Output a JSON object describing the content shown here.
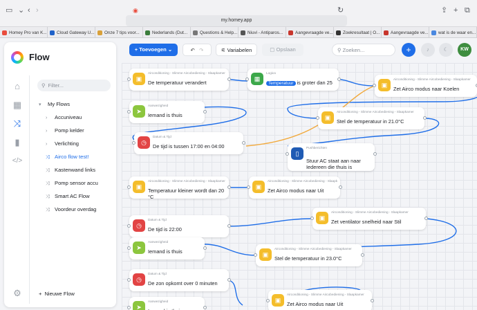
{
  "browser": {
    "url": "my.homey.app"
  },
  "bookmarks": [
    {
      "label": "Homey Pro van K...",
      "color": "#e94c3d"
    },
    {
      "label": "Cloud Gateway U...",
      "color": "#1f62c9"
    },
    {
      "label": "Onze 7 tips voor...",
      "color": "#d9a13a"
    },
    {
      "label": "Nederlands (Dut...",
      "color": "#3b7d3c"
    },
    {
      "label": "Questions & Help...",
      "color": "#777777"
    },
    {
      "label": "Niuvi - Antiparos...",
      "color": "#555555"
    },
    {
      "label": "Aangevraagde ve...",
      "color": "#c8362d"
    },
    {
      "label": "Zoekresultaat | O...",
      "color": "#333333"
    },
    {
      "label": "Aangevraagde ve...",
      "color": "#c8362d"
    },
    {
      "label": "wat is de waar en...",
      "color": "#4a88e0"
    }
  ],
  "sidebar": {
    "title": "Flow",
    "filter_placeholder": "Filter...",
    "nav_icons": [
      "home-icon",
      "devices-grid-icon",
      "flow-shuffle-icon",
      "insights-bars-icon",
      "code-icon"
    ],
    "tree": [
      {
        "label": "My Flows",
        "icon": "chevron-down-icon",
        "glyph": "▾",
        "level": 0
      },
      {
        "label": "Accuniveau",
        "icon": "chevron-right-icon",
        "glyph": "›",
        "level": 1
      },
      {
        "label": "Pomp kelder",
        "icon": "chevron-right-icon",
        "glyph": "›",
        "level": 1
      },
      {
        "label": "Verlichting",
        "icon": "chevron-right-icon",
        "glyph": "›",
        "level": 1
      },
      {
        "label": "Airco flow test!",
        "icon": "flow-shuffle-icon",
        "glyph": "⤨",
        "level": 1,
        "active": true
      },
      {
        "label": "Kastenwand links",
        "icon": "flow-shuffle-icon",
        "glyph": "⤨",
        "level": 1
      },
      {
        "label": "Pomp sensor accu",
        "icon": "flow-shuffle-icon",
        "glyph": "⤨",
        "level": 1
      },
      {
        "label": "Smart AC Flow",
        "icon": "flow-shuffle-icon",
        "glyph": "⤨",
        "level": 1
      },
      {
        "label": "Voordeur overdag",
        "icon": "flow-shuffle-icon",
        "glyph": "⤨",
        "level": 1
      }
    ],
    "new_flow": "Nieuwe Flow"
  },
  "toolbar": {
    "add_label": "Toevoegen",
    "variables_label": "Variabelen",
    "save_label": "Opslaan",
    "search_placeholder": "Zoeken...",
    "avatar": "KW"
  },
  "cards": [
    {
      "id": "c1",
      "kind": "airco",
      "title": "Airconditioning - Slimme Aircobediening - Slaapkamer",
      "body": "De temperatuur verandert"
    },
    {
      "id": "c2",
      "kind": "logic",
      "title": "Logica",
      "tag": "Temperatuur",
      "body": "is groter dan 25"
    },
    {
      "id": "c3",
      "kind": "airco",
      "title": "Airconditioning - Slimme Aircobediening - Slaapkamer",
      "body": "Zet Airco modus naar Koelen"
    },
    {
      "id": "c4",
      "kind": "presence",
      "title": "Aanwezigheid",
      "body": "Iemand is thuis"
    },
    {
      "id": "c5",
      "kind": "airco",
      "title": "Airconditioning - Slimme Aircobediening - Slaapkamer",
      "body": "Stel de temperatuur in 21.0°C"
    },
    {
      "id": "c6",
      "kind": "time",
      "title": "Datum & Tijd",
      "body": "De tijd is tussen 17:00 en 04:00"
    },
    {
      "id": "c7",
      "kind": "push",
      "title": "Pushberichten",
      "body": "Stuur AC staat aan naar Iedereen die thuis is"
    },
    {
      "id": "c8",
      "kind": "airco",
      "title": "Airconditioning - Slimme Aircobediening - Slaapkamer",
      "body": "Temperatuur kleiner wordt dan 20 °C"
    },
    {
      "id": "c9",
      "kind": "airco",
      "title": "Airconditioning - Slimme Aircobediening - Slaapkamer",
      "body": "Zet Airco modus naar Uit"
    },
    {
      "id": "c10",
      "kind": "time",
      "title": "Datum & Tijd",
      "body": "De tijd is 22:00"
    },
    {
      "id": "c11",
      "kind": "airco",
      "title": "Airconditioning - Slimme Aircobediening - Slaapkamer",
      "body": "Zet ventilator snelheid naar Stil"
    },
    {
      "id": "c12",
      "kind": "presence",
      "title": "Aanwezigheid",
      "body": "Iemand is thuis"
    },
    {
      "id": "c13",
      "kind": "airco",
      "title": "Airconditioning - Slimme Aircobediening - Slaapkamer",
      "body": "Stel de temperatuur in 23.0°C"
    },
    {
      "id": "c14",
      "kind": "time",
      "title": "Datum & Tijd",
      "body": "De zon opkomt over 0 minuten"
    },
    {
      "id": "c15",
      "kind": "presence",
      "title": "Aanwezigheid",
      "body": "Iemand is thuis"
    },
    {
      "id": "c16",
      "kind": "airco",
      "title": "Airconditioning - Slimme Aircobediening - Slaapkamer",
      "body": "Zet Airco modus naar Uit"
    }
  ],
  "colors": {
    "accent": "#1f6ee8",
    "airco": "#f4bd2b",
    "presence": "#8cc63e",
    "time": "#e24444",
    "logic": "#3ca84a",
    "push": "#1f5bb4",
    "wire": "#1f6ee8",
    "wire_yellow": "#f2a93b"
  }
}
